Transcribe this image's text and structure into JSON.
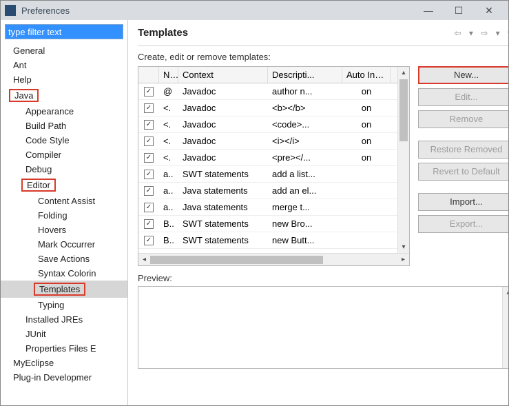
{
  "window": {
    "title": "Preferences"
  },
  "filter_placeholder": "type filter text",
  "tree": {
    "items": [
      {
        "label": "General",
        "level": 1
      },
      {
        "label": "Ant",
        "level": 1
      },
      {
        "label": "Help",
        "level": 1
      },
      {
        "label": "Java",
        "level": 1,
        "boxed": true
      },
      {
        "label": "Appearance",
        "level": 2
      },
      {
        "label": "Build Path",
        "level": 2
      },
      {
        "label": "Code Style",
        "level": 2
      },
      {
        "label": "Compiler",
        "level": 2
      },
      {
        "label": "Debug",
        "level": 2
      },
      {
        "label": "Editor",
        "level": 2,
        "boxed": true
      },
      {
        "label": "Content Assist",
        "level": 3
      },
      {
        "label": "Folding",
        "level": 3
      },
      {
        "label": "Hovers",
        "level": 3
      },
      {
        "label": "Mark Occurrer",
        "level": 3
      },
      {
        "label": "Save Actions",
        "level": 3
      },
      {
        "label": "Syntax Colorin",
        "level": 3
      },
      {
        "label": "Templates",
        "level": 3,
        "boxed": true,
        "selected": true
      },
      {
        "label": "Typing",
        "level": 3
      },
      {
        "label": "Installed JREs",
        "level": 2
      },
      {
        "label": "JUnit",
        "level": 2
      },
      {
        "label": "Properties Files E",
        "level": 2
      },
      {
        "label": "MyEclipse",
        "level": 1
      },
      {
        "label": "Plug-in Developmer",
        "level": 1
      }
    ]
  },
  "page": {
    "title": "Templates",
    "arrow_toolbar": "⇦ ▾ ⇨ ▾ ▾",
    "instruction": "Create, edit or remove templates:",
    "columns": {
      "name": "Na...",
      "context": "Context",
      "description": "Descripti...",
      "auto": "Auto Ins..."
    },
    "rows": [
      {
        "chk": true,
        "name": "@",
        "context": "Javadoc",
        "desc": "author n...",
        "auto": "on"
      },
      {
        "chk": true,
        "name": "<.",
        "context": "Javadoc",
        "desc": "<b></b>",
        "auto": "on"
      },
      {
        "chk": true,
        "name": "<.",
        "context": "Javadoc",
        "desc": "<code>...",
        "auto": "on"
      },
      {
        "chk": true,
        "name": "<.",
        "context": "Javadoc",
        "desc": "<i></i>",
        "auto": "on"
      },
      {
        "chk": true,
        "name": "<.",
        "context": "Javadoc",
        "desc": "<pre></...",
        "auto": "on"
      },
      {
        "chk": true,
        "name": "a..",
        "context": "SWT statements",
        "desc": "add a list...",
        "auto": ""
      },
      {
        "chk": true,
        "name": "a..",
        "context": "Java statements",
        "desc": "add an el...",
        "auto": ""
      },
      {
        "chk": true,
        "name": "a..",
        "context": "Java statements",
        "desc": "merge t...",
        "auto": ""
      },
      {
        "chk": true,
        "name": "B..",
        "context": "SWT statements",
        "desc": "new Bro...",
        "auto": ""
      },
      {
        "chk": true,
        "name": "B..",
        "context": "SWT statements",
        "desc": "new Butt...",
        "auto": ""
      }
    ],
    "buttons": {
      "new": "New...",
      "edit": "Edit...",
      "remove": "Remove",
      "restore": "Restore Removed",
      "revert": "Revert to Default",
      "import": "Import...",
      "export": "Export..."
    },
    "preview_label": "Preview:"
  }
}
